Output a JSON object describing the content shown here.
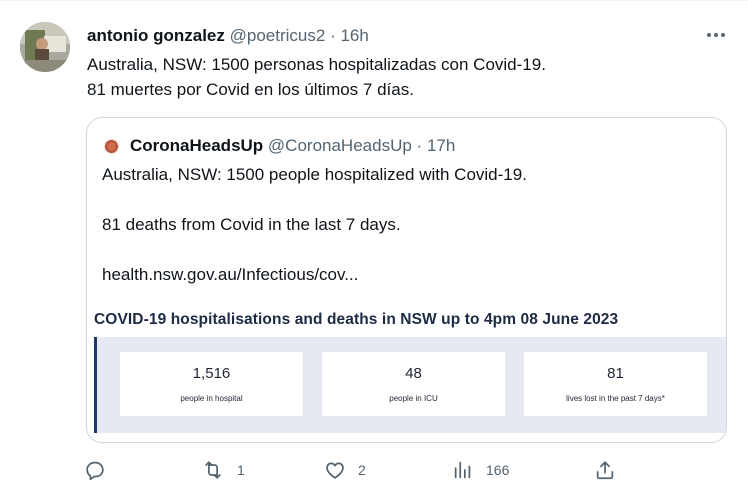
{
  "tweet": {
    "author_name": "antonio gonzalez",
    "author_handle": "@poetricus2",
    "separator": "·",
    "time": "16h",
    "text_lines": [
      "Australia, NSW: 1500 personas hospitalizadas con Covid-19.",
      "81 muertes por Covid en los últimos 7 días."
    ]
  },
  "quote": {
    "author_name": "CoronaHeadsUp",
    "author_handle": "@CoronaHeadsUp",
    "separator": "·",
    "time": "17h",
    "text_lines": [
      "Australia, NSW:  1500 people hospitalized with Covid-19.",
      "81 deaths from Covid in the last 7 days.",
      "health.nsw.gov.au/Infectious/cov..."
    ],
    "card": {
      "title": "COVID-19 hospitalisations and deaths in NSW up to 4pm 08 June 2023",
      "stats": [
        {
          "value": "1,516",
          "label": "people in hospital"
        },
        {
          "value": "48",
          "label": "people in ICU"
        },
        {
          "value": "81",
          "label": "lives lost in the past 7 days*"
        }
      ]
    }
  },
  "actions": {
    "reply": {
      "icon": "reply-icon",
      "count": ""
    },
    "retweet": {
      "icon": "retweet-icon",
      "count": "1"
    },
    "like": {
      "icon": "heart-icon",
      "count": "2"
    },
    "views": {
      "icon": "views-icon",
      "count": "166"
    },
    "share": {
      "icon": "share-icon",
      "count": ""
    }
  },
  "colors": {
    "text_primary": "#0f1419",
    "text_secondary": "#536471",
    "card_panel": "#e6e9f2",
    "card_accent": "#223667"
  }
}
